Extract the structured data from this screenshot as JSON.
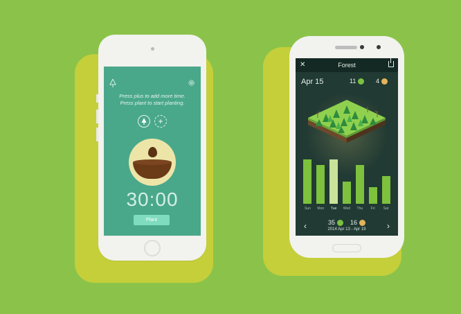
{
  "left_phone": {
    "hint_line1": "Press plus to add more time.",
    "hint_line2": "Press plant to start planting.",
    "timer": "30:00",
    "plant_label": "Plant",
    "icons": [
      "tree-icon",
      "settings-icon",
      "tree-mode-icon",
      "plus-icon"
    ],
    "colors": {
      "screen": "#4aa88a",
      "plant_button": "#7fdcbe"
    }
  },
  "right_phone": {
    "title": "Forest",
    "date": "Apr 15",
    "trees_count": "11",
    "dead_count": "4",
    "days": [
      "Sun",
      "Mon",
      "Tue",
      "Wed",
      "Thu",
      "Fri",
      "Sat"
    ],
    "bar_values": [
      0.8,
      0.7,
      0.8,
      0.4,
      0.7,
      0.3,
      0.5
    ],
    "selected_day": "Tue",
    "week_trees": "35",
    "week_dead": "16",
    "date_range": "2014 Apr 13 - Apr 19",
    "icons": [
      "close-icon",
      "share-icon",
      "prev-arrow-icon",
      "next-arrow-icon"
    ],
    "colors": {
      "screen": "#213a33",
      "bar": "#7dc13d",
      "bar_selected": "#c9e39a"
    }
  }
}
